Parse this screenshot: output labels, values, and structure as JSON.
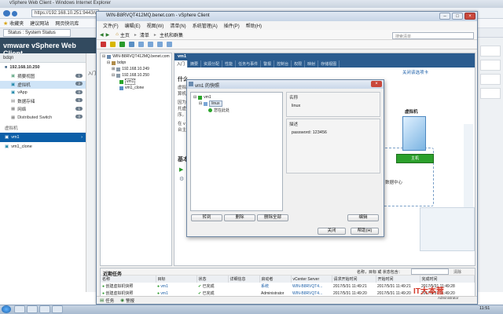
{
  "ie": {
    "title": "vSphere Web Client - Windows Internet Explorer",
    "url": "https://192.168.10.251:9443/vs",
    "favorites_label": "收藏夹",
    "fav_items": [
      "建议网站",
      "网页快讯库"
    ],
    "tab_label": "Status : System Status"
  },
  "web_client": {
    "logo": "vmware vSphere Web Client",
    "nav_head": "bdqn",
    "host": "192.168.10.250",
    "items": [
      {
        "label": "摘要视图",
        "count": "1"
      },
      {
        "label": "虚拟机",
        "count": "2"
      },
      {
        "label": "vApp",
        "count": "0"
      },
      {
        "label": "数据存储",
        "count": "1"
      },
      {
        "label": "网络",
        "count": "1"
      },
      {
        "label": "Distributed Switch",
        "count": "0"
      }
    ],
    "section": "虚拟机",
    "vms": [
      "vm1",
      "vm1_clone"
    ],
    "partial_text": "入门"
  },
  "client": {
    "title": "WIN-B8RVQT412MQ.benet.com - vSphere Client",
    "menu": [
      "文件(F)",
      "编辑(E)",
      "视图(W)",
      "清单(N)",
      "系统管理(A)",
      "插件(P)",
      "帮助(H)"
    ],
    "nav": [
      "主页",
      "清单",
      "主机和群集"
    ],
    "search_placeholder": "搜索清单",
    "tree": [
      {
        "label": "WIN-B8RVQT412MQ.benet.com",
        "level": 0
      },
      {
        "label": "bdqn",
        "level": 1
      },
      {
        "label": "192.168.10.249",
        "level": 2
      },
      {
        "label": "192.168.10.250",
        "level": 2
      },
      {
        "label": "vm1",
        "level": 3
      },
      {
        "label": "vm1_clone",
        "level": 3
      }
    ],
    "object_name": "vm1",
    "tabs": [
      "入门",
      "摘要",
      "资源分配",
      "性能",
      "任务与事件",
      "警报",
      "控制台",
      "权限",
      "映射",
      "存储视图"
    ],
    "close_tab": "关闭该选项卡",
    "getting_started": {
      "heading": "什么",
      "lines": [
        "虚拟",
        "算机",
        "因为",
        "托虚",
        "序。",
        "在 v",
        "台主"
      ],
      "basic": "基本"
    },
    "illustration": {
      "vm_label": "虚拟机",
      "host_label": "主机",
      "center_label": "数据中心"
    },
    "tasks": {
      "title": "近期任务",
      "filter_label": "名称，目标 或 状态包含：",
      "clear": "清除",
      "columns": [
        "名称",
        "目标",
        "状态",
        "详细信息",
        "启动者",
        "vCenter Server",
        "请求开始时间",
        "开始时间",
        "完成时间"
      ],
      "rows": [
        [
          "创建虚拟机快照",
          "vm1",
          "已完成",
          "",
          "系统",
          "WIN-B8RVQT4...",
          "2017/5/31 11:49:21",
          "2017/5/31 11:49:21",
          "2017/5/31 11:49:28"
        ],
        [
          "创建虚拟机快照",
          "vm1",
          "已完成",
          "",
          "Administrator",
          "WIN-B8RVQT4...",
          "2017/5/31 11:49:20",
          "2017/5/31 11:49:20",
          "2017/5/31 11:49:20"
        ]
      ]
    },
    "status_bar": [
      "任务",
      "警报"
    ]
  },
  "dialog": {
    "title": "vm1 的快照",
    "tree": [
      {
        "label": "vm1",
        "level": 0
      },
      {
        "label": "linux",
        "level": 1
      },
      {
        "label": "您在此处",
        "level": 2
      }
    ],
    "name_label": "名称",
    "name_value": "linux",
    "desc_label": "描述",
    "desc_value": "password: 123456",
    "buttons": {
      "goto": "转到",
      "delete": "删除",
      "delete_all": "删除全部",
      "edit": "编辑",
      "close": "关闭",
      "help": "帮助(H)"
    }
  },
  "taskbar": {
    "time": "11:51",
    "watermark": "IT大本营",
    "watermark_sub": "Administrator"
  },
  "colors": {
    "accent": "#2b5c8f",
    "web_header": "#324a5f",
    "selected_vm": "#0b5ea8",
    "green_ok": "#2aa52a"
  }
}
